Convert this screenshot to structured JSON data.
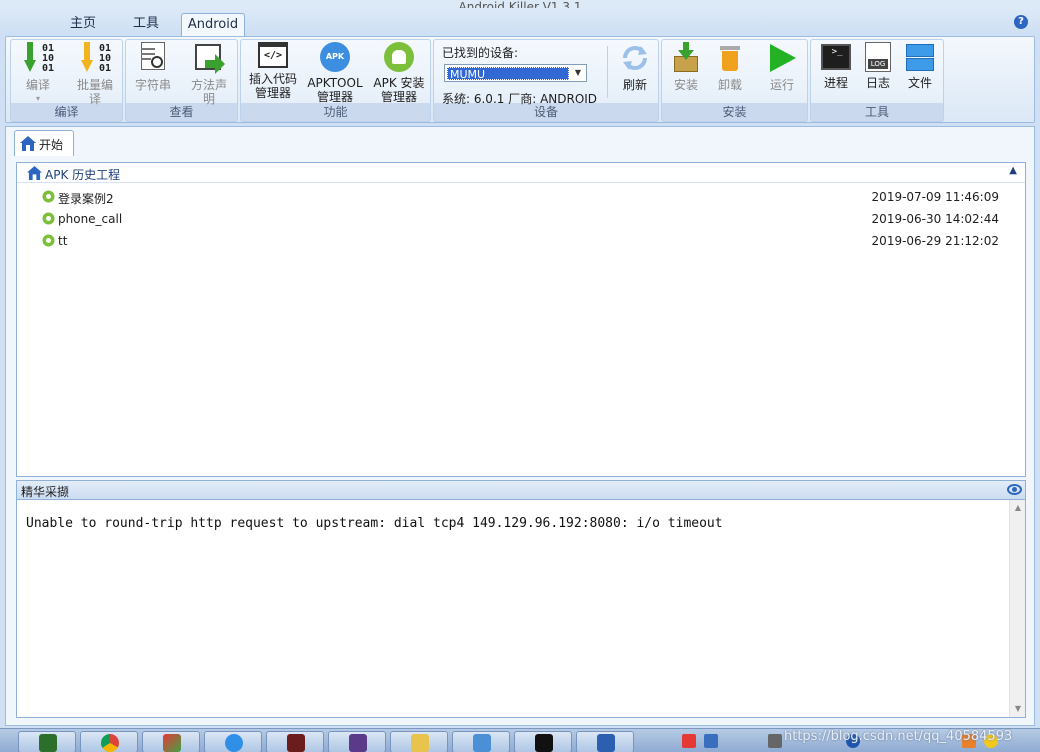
{
  "window": {
    "title": "Android Killer V1.3.1"
  },
  "ribbon_tabs": [
    {
      "label": "主页"
    },
    {
      "label": "工具"
    },
    {
      "label": "Android"
    }
  ],
  "help_label": "?",
  "groups": {
    "compile": {
      "label": "编译",
      "buttons": {
        "compile": "编译",
        "batch_compile_1": "批量编",
        "batch_compile_2": "译"
      }
    },
    "view": {
      "label": "查看",
      "buttons": {
        "strings": "字符串",
        "method_1": "方法声",
        "method_2": "明"
      }
    },
    "function": {
      "label": "功能",
      "buttons": {
        "insert_1": "插入代码",
        "insert_2": "管理器",
        "apktool_1": "APKTOOL",
        "apktool_2": "管理器",
        "apkinstall_1": "APK 安装",
        "apkinstall_2": "管理器"
      }
    },
    "device": {
      "label": "设备",
      "found_label": "已找到的设备:",
      "selected": "MUMU",
      "info": "系统: 6.0.1   厂商: ANDROID",
      "refresh": "刷新"
    },
    "install": {
      "label": "安装",
      "buttons": {
        "install": "安装",
        "uninstall": "卸载",
        "run": "运行"
      }
    },
    "tools": {
      "label": "工具",
      "buttons": {
        "process": "进程",
        "log": "日志",
        "file": "文件"
      }
    }
  },
  "icons": {
    "code_icon_text": "</>",
    "apk_badge": "APK",
    "log_badge": "LOG",
    "bin_text": "01\n10\n01"
  },
  "doc_tab": {
    "label": "开始"
  },
  "history": {
    "title": "APK 历史工程",
    "collapse": "▲",
    "items": [
      {
        "name": "登录案例2",
        "date": "2019-07-09 11:46:09"
      },
      {
        "name": "phone_call",
        "date": "2019-06-30 14:02:44"
      },
      {
        "name": "tt",
        "date": "2019-06-29 21:12:02"
      }
    ]
  },
  "digest": {
    "title": "精华采撷",
    "message": "Unable to round-trip http request to upstream: dial tcp4 149.129.96.192:8080: i/o timeout"
  },
  "taskbar": {
    "watermark": "https://blog.csdn.net/qq_40584593"
  },
  "colors": {
    "accent": "#2d66c1",
    "green": "#3aa12e",
    "orange": "#f0a21e"
  }
}
